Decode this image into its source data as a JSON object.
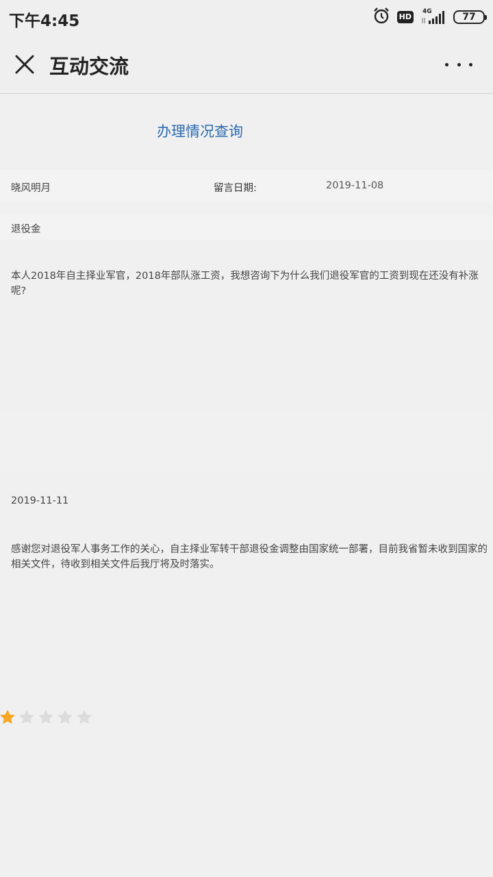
{
  "status_bar": {
    "time": "下午4:45",
    "icons": [
      "alarm-icon",
      "hd-icon",
      "signal-4g-icon",
      "battery-icon"
    ],
    "hd_label": "HD",
    "network_label": "4G",
    "battery_level": "77"
  },
  "header": {
    "title": "互动交流",
    "close_icon": "close-icon",
    "more_icon": "more-dots-icon"
  },
  "main": {
    "section_heading": "办理情况查询",
    "author": "晓风明月",
    "date_label": "留言日期:",
    "date_value": "2019-11-08",
    "category": "退役金",
    "question": "本人2018年自主择业军官，2018年部队涨工资，我想咨询下为什么我们退役军官的工资到现在还没有补涨呢?",
    "reply_date": "2019-11-11",
    "reply": "感谢您对退役军人事务工作的关心，自主择业军转干部退役金调整由国家统一部署，目前我省暂未收到国家的相关文件，待收到相关文件后我厅将及时落实。"
  },
  "rating": {
    "value": 1,
    "max": 5,
    "filled_color": "#f5a623",
    "empty_color": "#dcdcdc"
  },
  "colors": {
    "accent": "#2c6bb0",
    "background": "#f0f0f0"
  }
}
